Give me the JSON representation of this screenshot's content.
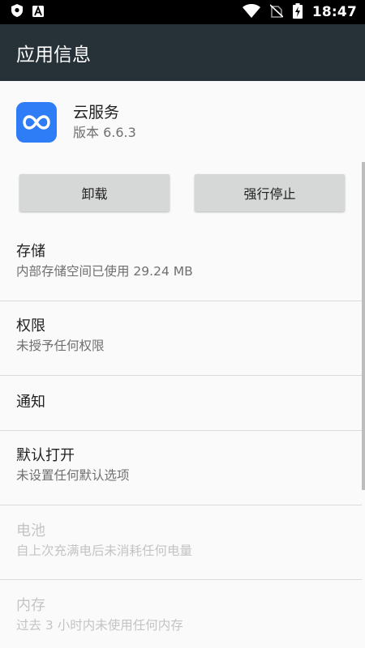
{
  "status_bar": {
    "time": "18:47",
    "icons": [
      "shield-icon",
      "a-letter-icon",
      "wifi-icon",
      "no-sim-icon",
      "battery-charging-icon"
    ]
  },
  "app_bar": {
    "title": "应用信息"
  },
  "app": {
    "name": "云服务",
    "version": "版本 6.6.3",
    "icon_color": "#2e7cf6"
  },
  "buttons": {
    "uninstall": "卸载",
    "force_stop": "强行停止"
  },
  "settings": {
    "storage": {
      "title": "存储",
      "summary": "内部存储空间已使用 29.24 MB"
    },
    "permissions": {
      "title": "权限",
      "summary": "未授予任何权限"
    },
    "notifications": {
      "title": "通知"
    },
    "open_by_default": {
      "title": "默认打开",
      "summary": "未设置任何默认选项"
    },
    "battery": {
      "title": "电池",
      "summary": "自上次充满电后未消耗任何电量",
      "enabled": false
    },
    "memory": {
      "title": "内存",
      "summary": "过去 3 小时内未使用任何内存",
      "enabled": false
    }
  },
  "colors": {
    "app_bar": "#263238",
    "status_bar": "#000000",
    "background": "#fafafa",
    "button": "#d6d7d7"
  }
}
